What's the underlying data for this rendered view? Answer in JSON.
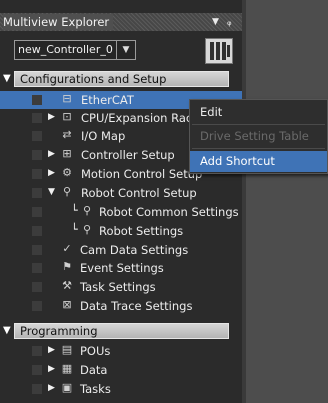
{
  "panel": {
    "title": "Multiview Explorer",
    "pin_glyph": "▾",
    "close_glyph": "ᚎ"
  },
  "controller": {
    "selected": "new_Controller_0",
    "dropdown_glyph": "▼"
  },
  "sections": [
    {
      "label": "Configurations and Setup"
    },
    {
      "label": "Programming"
    }
  ],
  "tree": [
    {
      "label": "EtherCAT",
      "icon": "ethercat-icon",
      "selected": true
    },
    {
      "label": "CPU/Expansion Racks",
      "icon": "rack-icon",
      "expander": "▶"
    },
    {
      "label": "I/O Map",
      "icon": "io-map-icon"
    },
    {
      "label": "Controller Setup",
      "icon": "controller-setup-icon",
      "expander": "▶"
    },
    {
      "label": "Motion Control Setup",
      "icon": "gear-icon",
      "expander": "▶"
    },
    {
      "label": "Robot Control Setup",
      "icon": "robot-icon",
      "expander": "▼"
    },
    {
      "label": "Robot Common Settings",
      "icon": "robot-settings-icon"
    },
    {
      "label": "Robot Settings",
      "icon": "robot-icon"
    },
    {
      "label": "Cam Data Settings",
      "icon": "cam-icon"
    },
    {
      "label": "Event Settings",
      "icon": "flag-icon"
    },
    {
      "label": "Task Settings",
      "icon": "task-icon"
    },
    {
      "label": "Data Trace Settings",
      "icon": "trace-icon"
    }
  ],
  "programming": [
    {
      "label": "POUs",
      "icon": "pou-icon",
      "expander": "▶"
    },
    {
      "label": "Data",
      "icon": "table-icon",
      "expander": "▶"
    },
    {
      "label": "Tasks",
      "icon": "tasks-icon",
      "expander": "▶"
    }
  ],
  "context_menu": {
    "items": [
      {
        "label": "Edit",
        "state": "normal"
      },
      {
        "label": "Drive Setting Table",
        "state": "disabled"
      },
      {
        "label": "Add Shortcut",
        "state": "highlight"
      }
    ]
  }
}
